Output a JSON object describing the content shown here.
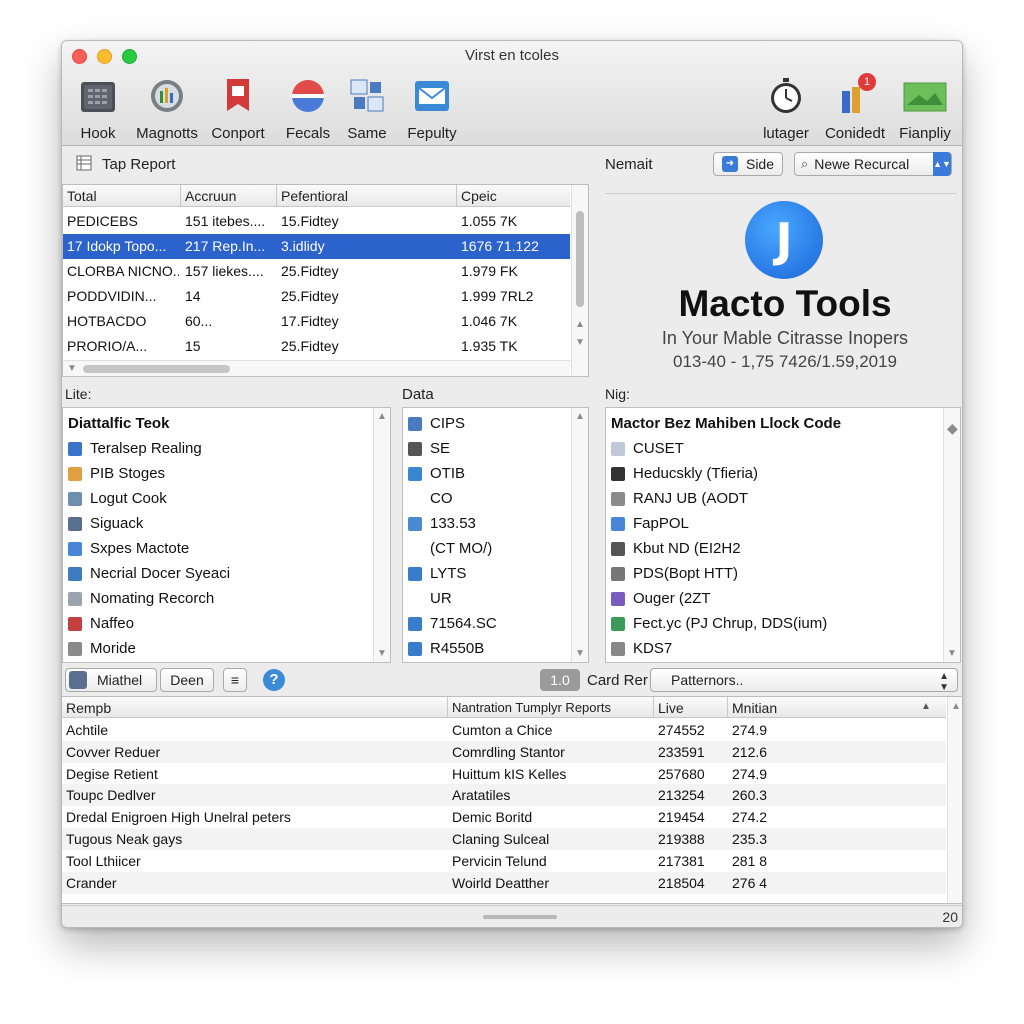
{
  "window": {
    "title": "Virst en tcoles"
  },
  "toolbar": {
    "left": [
      {
        "label": "Hook",
        "icon": "calculator-icon"
      },
      {
        "label": "Magnotts",
        "icon": "magnifier-icon"
      },
      {
        "label": "Conport",
        "icon": "bookmark-icon"
      },
      {
        "label": "Fecals",
        "icon": "color-wheel-icon"
      },
      {
        "label": "Same",
        "icon": "network-icon"
      },
      {
        "label": "Fepulty",
        "icon": "mail-icon"
      }
    ],
    "right": [
      {
        "label": "lutager",
        "icon": "stopwatch-icon"
      },
      {
        "label": "Conidedt",
        "icon": "notification-icon",
        "badge": "1"
      },
      {
        "label": "Fianpliy",
        "icon": "landscape-icon"
      }
    ]
  },
  "report": {
    "title": "Tap Report",
    "columns": [
      "Total",
      "Accruun",
      "Pefentioral",
      "Cpeic"
    ],
    "rows": [
      [
        "PEDICEBS",
        "151 itebes....",
        "15.Fidtey",
        "1.055 7K"
      ],
      [
        "17 Idokp Topo...",
        "217 Rep.In...",
        "3.idlidy",
        "1676 71.122"
      ],
      [
        "CLORBA NICNO...",
        "157 liekes....",
        "25.Fidtey",
        "1.979 FK"
      ],
      [
        "PODDVIDIN...",
        "14",
        "25.Fidtey",
        "1.999 7RL2"
      ],
      [
        "HOTBACDO",
        "60...",
        "17.Fidtey",
        "1.046 7K"
      ],
      [
        "PRORIO/A...",
        "15",
        "25.Fidtey",
        "1.935 TK"
      ]
    ],
    "selected_row": 1
  },
  "nemait": {
    "label": "Nemait",
    "side_button": "Side",
    "search_value": "Newe Recurcal",
    "app_name": "Macto Tools",
    "tagline": "In Your Mable Citrasse Inopers",
    "version": "013-40 - 1,75 7426/1.59,2019",
    "logo_letter": "J"
  },
  "lite": {
    "label": "Lite:",
    "items": [
      {
        "label": "Diattalfic Teok",
        "color": ""
      },
      {
        "label": "Teralsep Realing",
        "color": "#3a74c9"
      },
      {
        "label": "PIB Stoges",
        "color": "#e0a040"
      },
      {
        "label": "Logut Cook",
        "color": "#6f8fb0"
      },
      {
        "label": "Siguack",
        "color": "#5a6f8f"
      },
      {
        "label": "Sxpes Mactote",
        "color": "#4a86d8"
      },
      {
        "label": "Necrial Docer Syeaci",
        "color": "#3d7cc0"
      },
      {
        "label": "Nomating Recorch",
        "color": "#9aa4b0"
      },
      {
        "label": "Naffeo",
        "color": "#c24040"
      },
      {
        "label": "Moride",
        "color": "#8a8a8a"
      }
    ]
  },
  "data_panel": {
    "label": "Data",
    "items": [
      {
        "label": "CIPS",
        "color": "#4a7bbf"
      },
      {
        "label": "SE",
        "color": "#555555"
      },
      {
        "label": "OTIB",
        "color": "#3a86d0"
      },
      {
        "label": "CO",
        "color": ""
      },
      {
        "label": "133.53",
        "color": "#4a8ad0"
      },
      {
        "label": "(CT MO/)",
        "color": ""
      },
      {
        "label": "LYTS",
        "color": "#3a7ccc"
      },
      {
        "label": "UR",
        "color": ""
      },
      {
        "label": "71564.SC",
        "color": "#3a7ccc"
      },
      {
        "label": "R4550B",
        "color": "#3a7ccc"
      }
    ]
  },
  "nig": {
    "label": "Nig:",
    "items": [
      {
        "label": "Mactor Bez Mahiben Llock Code",
        "color": ""
      },
      {
        "label": "CUSET",
        "color": "#c0c8d8"
      },
      {
        "label": "Heducskly (Tfieria)",
        "color": "#333333"
      },
      {
        "label": "RANJ UB (AODT",
        "color": "#8a8a8a"
      },
      {
        "label": "FapPOL",
        "color": "#4a86d8"
      },
      {
        "label": "Kbut ND (EI2H2",
        "color": "#555555"
      },
      {
        "label": "PDS(Bopt HTT)",
        "color": "#777777"
      },
      {
        "label": "Ouger (2ZT",
        "color": "#7a5cc0"
      },
      {
        "label": "Fect.yc (PJ Chrup, DDS(ium)",
        "color": "#3a9a5a"
      },
      {
        "label": "KDS7",
        "color": "#888888"
      }
    ]
  },
  "midbar": {
    "mathel": "Miathel",
    "deen": "Deen",
    "menu_glyph": "≡",
    "help": "?",
    "count": "1.0",
    "card_rer": "Card Rer",
    "pattern_value": "Patternors.."
  },
  "bottom_table": {
    "columns": [
      "Rempb",
      "Nantration Tumplyr Reports",
      "Live",
      "Mnitian"
    ],
    "rows": [
      [
        "Achtile",
        "Cumton a Chice",
        "274552",
        "274.9"
      ],
      [
        "Covver Reduer",
        "Comrdling Stantor",
        "233591",
        "212.6"
      ],
      [
        "Degise Retient",
        "Huittum kIS Kelles",
        "257680",
        "274.9"
      ],
      [
        "Toupc Dedlver",
        "Aratatiles",
        "213254",
        "260.3"
      ],
      [
        "Dredal Enigroen High Unelral peters",
        "Demic Boritd",
        "219454",
        "274.2"
      ],
      [
        "Tugous Neak gays",
        "Claning Sulceal",
        "219388",
        "235.3"
      ],
      [
        "Tool Lthiicer",
        "Pervicin Telund",
        "217381",
        "281 8"
      ],
      [
        "Crander",
        "Woirld Deatther",
        "218504",
        "276 4"
      ]
    ]
  },
  "status": {
    "page": "20"
  }
}
